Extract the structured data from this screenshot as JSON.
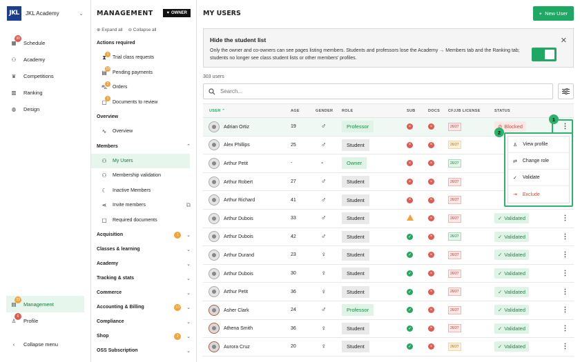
{
  "org": {
    "logo": "JKL",
    "name": "JKL Academy"
  },
  "rail": {
    "items": [
      {
        "label": "Schedule",
        "icon": "calendar-icon",
        "badge": "30"
      },
      {
        "label": "Academy",
        "icon": "users-icon"
      },
      {
        "label": "Competitions",
        "icon": "trophy-icon"
      },
      {
        "label": "Ranking",
        "icon": "podium-icon"
      },
      {
        "label": "Design",
        "icon": "palette-icon"
      }
    ],
    "bottom": [
      {
        "label": "Management",
        "icon": "building-icon",
        "badge": "33"
      },
      {
        "label": "Profile",
        "icon": "person-icon",
        "badge": "6"
      },
      {
        "label": "Collapse menu",
        "icon": "chevron-left-icon"
      }
    ]
  },
  "menu": {
    "title": "MANAGEMENT",
    "owner": "OWNER",
    "expand_all": "Expand all",
    "collapse_all": "Collapse all",
    "actions_title": "Actions required",
    "actions": [
      {
        "label": "Trial class requests",
        "badge": "1"
      },
      {
        "label": "Pending payments",
        "badge": "10"
      },
      {
        "label": "Orders",
        "badge": "2"
      },
      {
        "label": "Documents to review",
        "badge": "1"
      }
    ],
    "overview_title": "Overview",
    "overview_item": "Overview",
    "members_title": "Members",
    "members": [
      "My Users",
      "Membership validation",
      "Inactive Members",
      "Invite members",
      "Required documents"
    ],
    "sections": [
      {
        "label": "Acquisition",
        "badge": "1"
      },
      {
        "label": "Classes & learning"
      },
      {
        "label": "Academy"
      },
      {
        "label": "Tracking & stats"
      },
      {
        "label": "Commerce"
      },
      {
        "label": "Accounting & Billing",
        "badge": "10"
      },
      {
        "label": "Compliance"
      },
      {
        "label": "Shop",
        "badge": "2"
      },
      {
        "label": "OSS Subscription"
      }
    ]
  },
  "main": {
    "title": "MY USERS",
    "new_user": "New User",
    "banner": {
      "title": "Hide the student list",
      "text": "Only the owner and co-owners can see pages listing members. Students and professors lose the Academy → Members tab and the Ranking tab; students no longer see class student lists or other members' profiles."
    },
    "count": "303 users",
    "search_placeholder": "Search...",
    "columns": [
      "USER",
      "AGE",
      "GENDER",
      "ROLE",
      "SUB",
      "DOCS",
      "CFJJB LICENSE",
      "STATUS"
    ],
    "rows": [
      {
        "name": "Adrian Ortiz",
        "age": "19",
        "gender": "♂",
        "role": "Professor",
        "sub": "x",
        "docs": "x",
        "lic": "26/27",
        "lic_color": "r",
        "status": "Blocked"
      },
      {
        "name": "Alex Phillips",
        "age": "25",
        "gender": "♂",
        "role": "Student",
        "sub": "x",
        "docs": "x",
        "lic": "26/27",
        "lic_color": "y",
        "status": ""
      },
      {
        "name": "Arthur Petit",
        "age": "-",
        "gender": "-",
        "role": "Owner",
        "sub": "x",
        "docs": "x",
        "lic": "26/27",
        "lic_color": "g",
        "status": ""
      },
      {
        "name": "Arthur Robert",
        "age": "27",
        "gender": "♂",
        "role": "Student",
        "sub": "x",
        "docs": "x",
        "lic": "26/27",
        "lic_color": "r",
        "status": ""
      },
      {
        "name": "Arthur Richard",
        "age": "41",
        "gender": "♂",
        "role": "Student",
        "sub": "x",
        "docs": "x",
        "lic": "26/27",
        "lic_color": "r",
        "status": ""
      },
      {
        "name": "Arthur Dubois",
        "age": "33",
        "gender": "♂",
        "role": "Student",
        "sub": "w",
        "docs": "x",
        "lic": "26/27",
        "lic_color": "r",
        "status": "Validated"
      },
      {
        "name": "Arthur Dubois",
        "age": "42",
        "gender": "♂",
        "role": "Student",
        "sub": "ok",
        "docs": "x",
        "lic": "26/27",
        "lic_color": "g",
        "status": "Validated"
      },
      {
        "name": "Arthur Durand",
        "age": "23",
        "gender": "♀",
        "role": "Student",
        "sub": "ok",
        "docs": "x",
        "lic": "26/27",
        "lic_color": "r",
        "status": "Validated"
      },
      {
        "name": "Arthur Dubois",
        "age": "30",
        "gender": "♀",
        "role": "Student",
        "sub": "ok",
        "docs": "x",
        "lic": "26/27",
        "lic_color": "r",
        "status": "Validated"
      },
      {
        "name": "Arthur Petit",
        "age": "36",
        "gender": "♀",
        "role": "Student",
        "sub": "ok",
        "docs": "x",
        "lic": "26/27",
        "lic_color": "r",
        "status": "Validated"
      },
      {
        "name": "Asher Clark",
        "age": "24",
        "gender": "♂",
        "role": "Professor",
        "sub": "ok",
        "docs": "x",
        "lic": "26/27",
        "lic_color": "r",
        "status": "Validated"
      },
      {
        "name": "Athena Smith",
        "age": "36",
        "gender": "♀",
        "role": "Student",
        "sub": "ok",
        "docs": "x",
        "lic": "26/27",
        "lic_color": "r",
        "status": "Validated"
      },
      {
        "name": "Aurora Cruz",
        "age": "20",
        "gender": "♀",
        "role": "Student",
        "sub": "ok",
        "docs": "x",
        "lic": "26/27",
        "lic_color": "y",
        "status": "Validated"
      }
    ],
    "dropdown": [
      "View profile",
      "Change role",
      "Validate",
      "Exclude"
    ],
    "markers": [
      "1",
      "2"
    ]
  }
}
